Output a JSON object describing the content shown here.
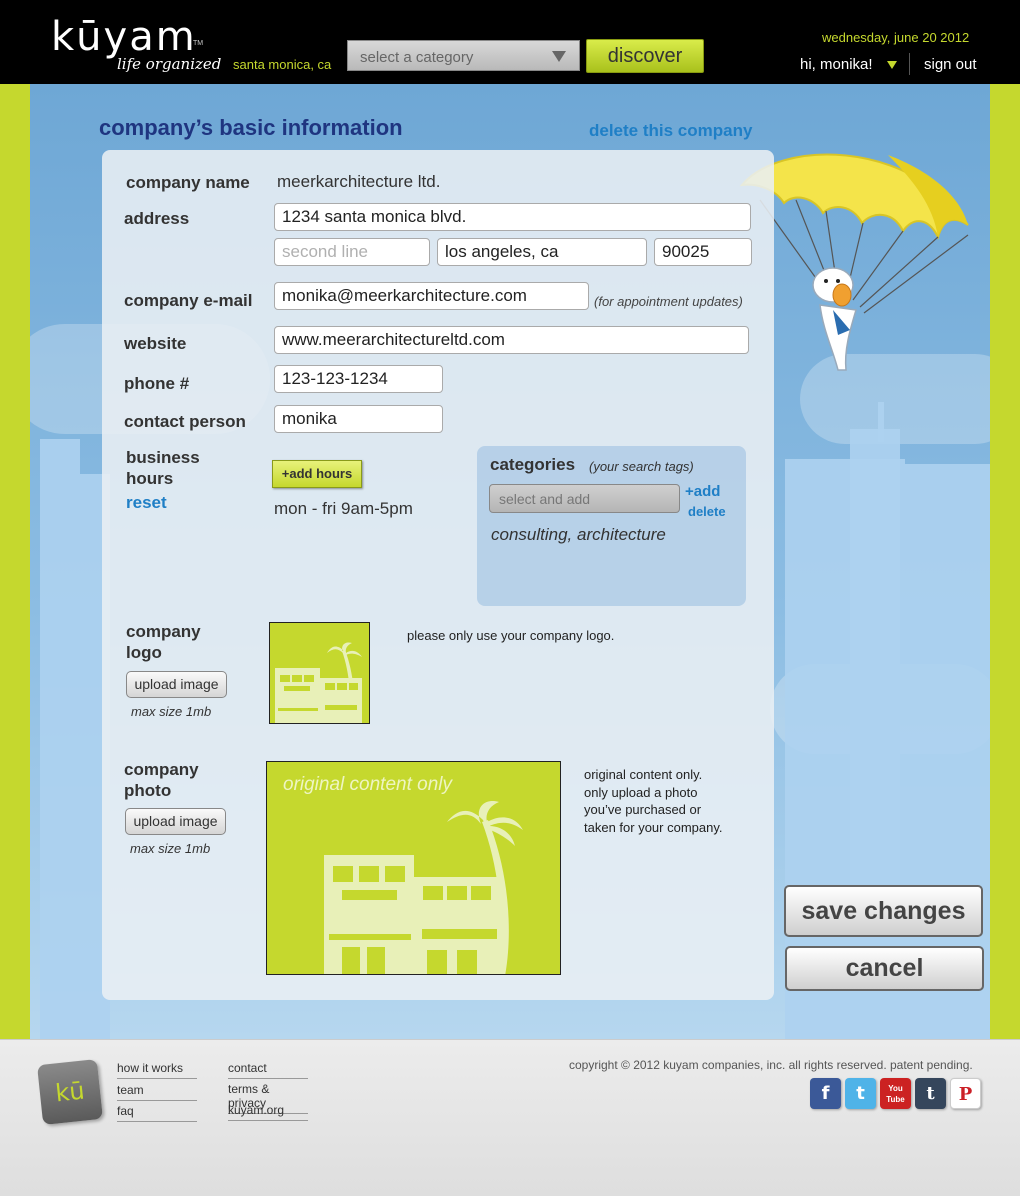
{
  "header": {
    "logo_text": "kūyam",
    "logo_tm": "TM",
    "tagline": "life organized",
    "location": "santa monica, ca",
    "category_select": "select a category",
    "discover_label": "discover",
    "date": "wednesday, june 20 2012",
    "greeting": "hi, monika!",
    "sign_out": "sign out",
    "accent_color": "#c5d82e"
  },
  "page": {
    "title": "company’s basic information",
    "delete_company": "delete this company"
  },
  "form": {
    "company_name": {
      "label": "company name",
      "value": "meerkarchitecture ltd."
    },
    "address": {
      "label": "address",
      "line1": "1234 santa monica blvd.",
      "line2_placeholder": "second line",
      "city": "los angeles, ca",
      "zip": "90025"
    },
    "email": {
      "label": "company e-mail",
      "value": "monika@meerkarchitecture.com",
      "hint": "(for appointment updates)"
    },
    "website": {
      "label": "website",
      "value": "www.meerarchitectureltd.com"
    },
    "phone": {
      "label": "phone #",
      "value": "123-123-1234"
    },
    "contact": {
      "label": "contact person",
      "value": "monika"
    },
    "hours": {
      "label_line1": "business",
      "label_line2": "hours",
      "reset": "reset",
      "add_label": "+add hours",
      "value": "mon - fri 9am-5pm"
    },
    "categories": {
      "title": "categories",
      "subtitle": "(your search tags)",
      "input_placeholder": "select and add",
      "add": "+add",
      "delete": "delete",
      "selected": "consulting, architecture"
    },
    "logo": {
      "label_line1": "company",
      "label_line2": "logo",
      "upload": "upload image",
      "max_size": "max size 1mb",
      "note": "please only use your company logo."
    },
    "photo": {
      "label_line1": "company",
      "label_line2": "photo",
      "upload": "upload image",
      "max_size": "max size 1mb",
      "caption": "original content only",
      "note_lines": [
        "original content only.",
        "only upload a photo",
        "you’ve purchased or",
        "taken for your company."
      ]
    },
    "save_label": "save changes",
    "cancel_label": "cancel"
  },
  "footer": {
    "logo_text": "kū",
    "col1": [
      "how it works",
      "team",
      "faq"
    ],
    "col2": [
      "contact",
      "terms & privacy",
      "kuyam.org"
    ],
    "copyright": "copyright © 2012 kuyam companies, inc. all rights reserved. patent pending.",
    "social": [
      {
        "icon": "facebook-icon",
        "glyph": "f",
        "color": "#3b5998"
      },
      {
        "icon": "twitter-icon",
        "glyph": "t",
        "color": "#4fb3e8"
      },
      {
        "icon": "youtube-icon",
        "glyph": "You Tube",
        "color": "#cc2222"
      },
      {
        "icon": "tumblr-icon",
        "glyph": "t",
        "color": "#35465c"
      },
      {
        "icon": "pinterest-icon",
        "glyph": "P",
        "color": "#cb2027"
      }
    ]
  }
}
